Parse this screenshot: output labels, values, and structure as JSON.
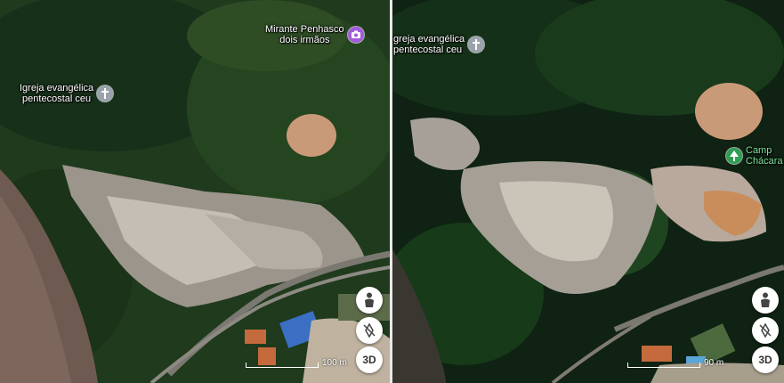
{
  "left_panel": {
    "pois": {
      "mirante": {
        "line1": "Mirante Penhasco",
        "line2": "dois irmãos",
        "icon": "camera-icon"
      },
      "igreja": {
        "line1": "Igreja evangélica",
        "line2": "pentecostal ceu",
        "icon": "church-cross-icon"
      }
    },
    "scale_label": "100 m",
    "controls": {
      "pegman_icon": "person-icon",
      "rotate_icon": "compass-rotate-icon",
      "view3d_label": "3D"
    }
  },
  "right_panel": {
    "pois": {
      "igreja": {
        "line1": "Igreja evangélica",
        "line2": "pentecostal ceu",
        "icon": "church-cross-icon"
      },
      "campo": {
        "line1": "Camp",
        "line2": "Chácara",
        "icon": "park-tree-icon"
      }
    },
    "scale_label": "90 m",
    "controls": {
      "pegman_icon": "person-icon",
      "rotate_icon": "compass-rotate-icon",
      "view3d_label": "3D"
    }
  },
  "colors": {
    "forest_dark": "#14301a",
    "forest_mid": "#2b4a22",
    "dirt_field": "#c99a78",
    "rock": "#6e5a50",
    "church_pin": "#9aa3ad",
    "camera_pin": "#a35bdc",
    "park_pin": "#2f9e55"
  }
}
